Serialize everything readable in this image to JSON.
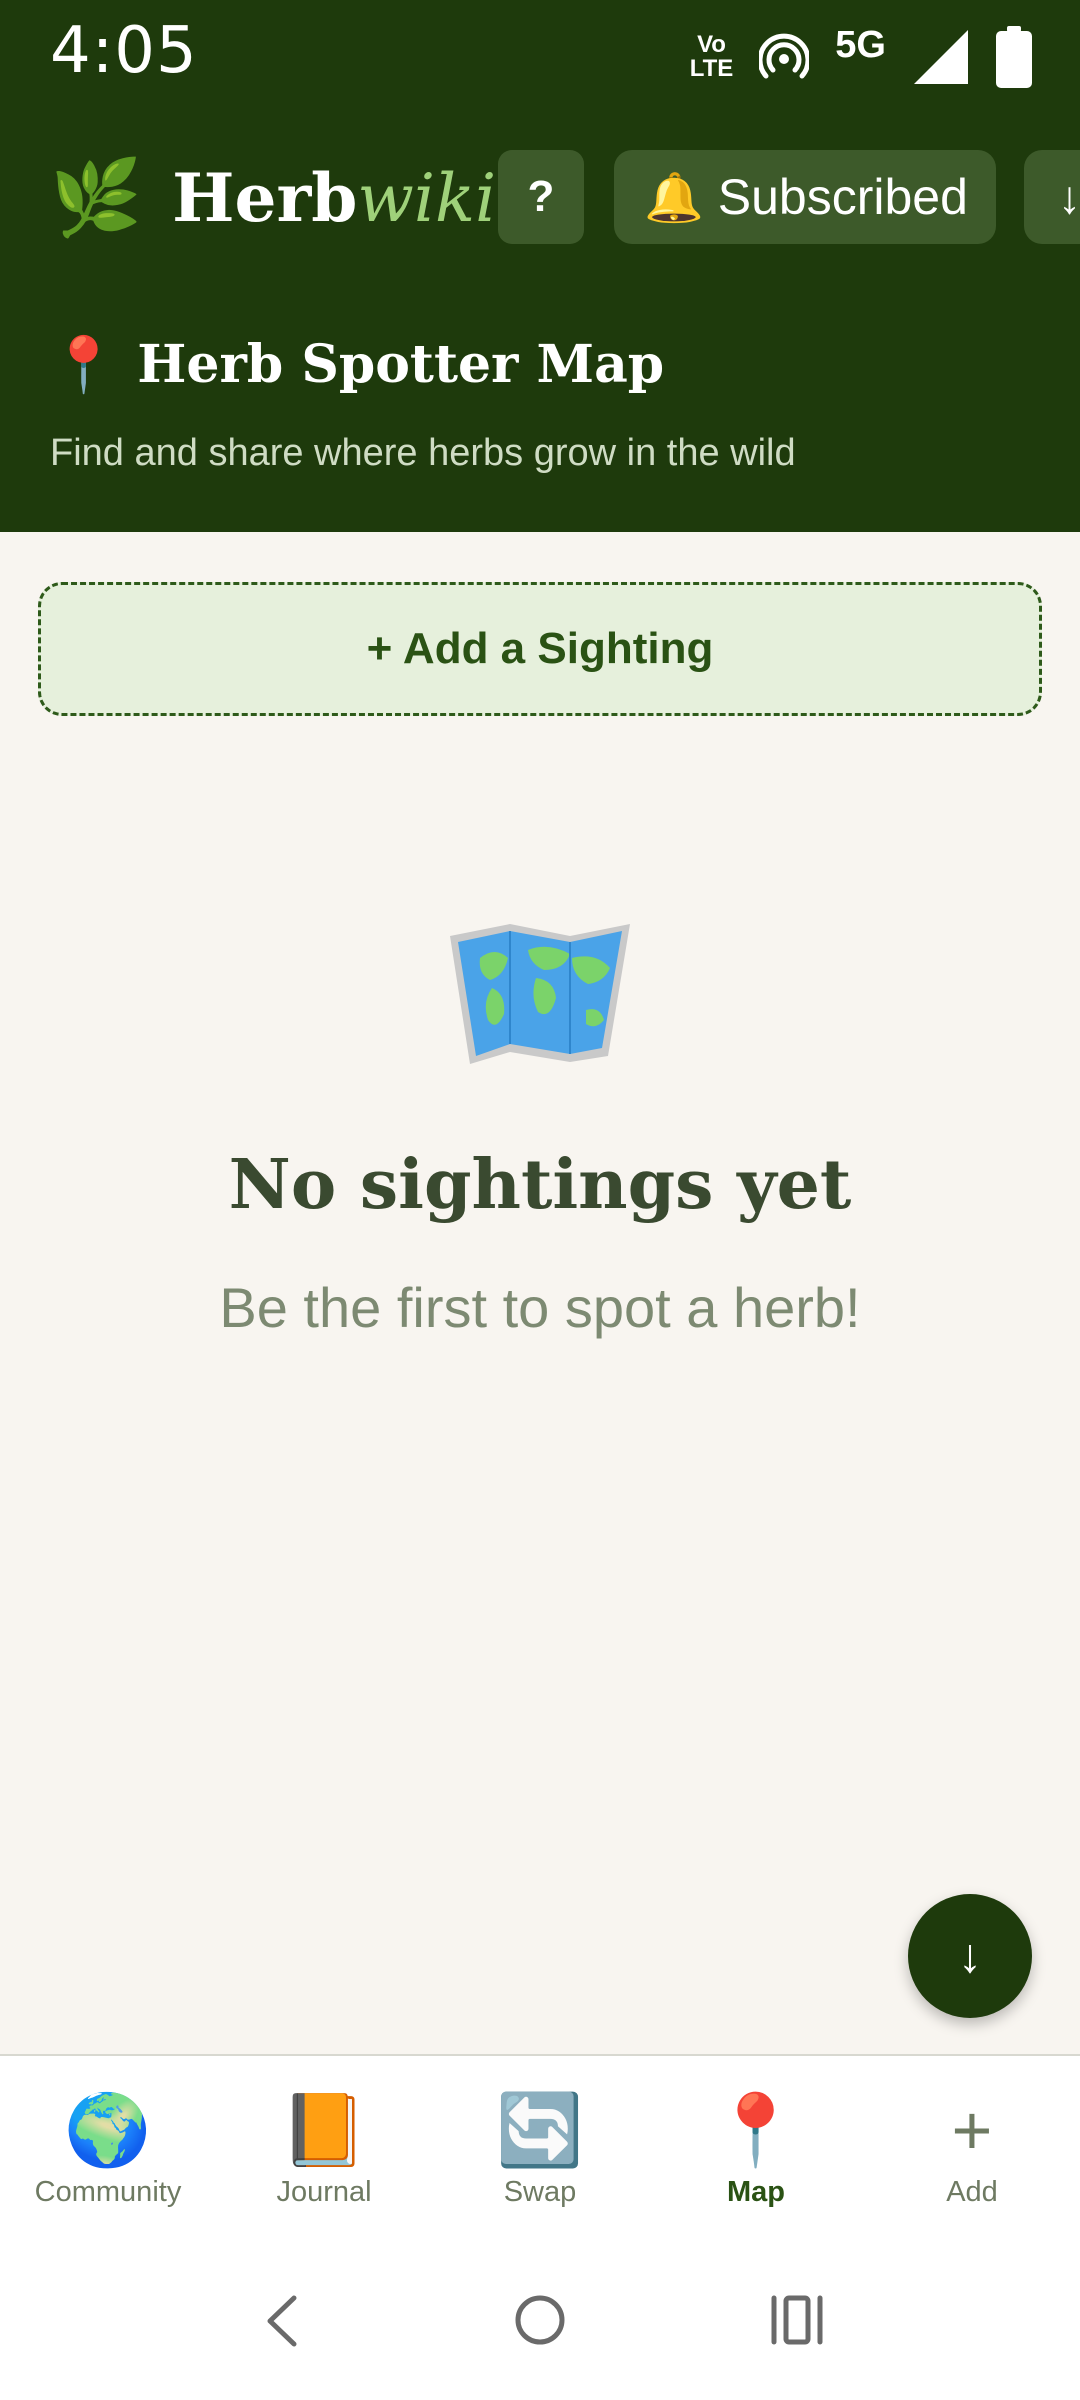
{
  "status_bar": {
    "time": "4:05",
    "volte_line1": "Vo",
    "volte_line2": "LTE",
    "network": "5G"
  },
  "header": {
    "brand_prefix": "Herb",
    "brand_suffix": "wiki",
    "leaf_icon": "🌿",
    "help_label": "?",
    "subscribe_icon": "🔔",
    "subscribe_label": "Subscribed",
    "more_label": "↓",
    "title_icon": "📍",
    "title": "Herb Spotter Map",
    "subtitle": "Find and share where herbs grow in the wild"
  },
  "main": {
    "add_sighting_label": "+ Add a Sighting",
    "empty_title": "No sightings yet",
    "empty_subtitle": "Be the first to spot a herb!"
  },
  "fab": {
    "label": "↓"
  },
  "bottom_nav": {
    "items": [
      {
        "icon": "🌍",
        "label": "Community"
      },
      {
        "icon": "📙",
        "label": "Journal"
      },
      {
        "icon": "🔄",
        "label": "Swap"
      },
      {
        "icon": "📍",
        "label": "Map"
      },
      {
        "icon": "+",
        "label": "Add"
      }
    ],
    "active": "Map"
  },
  "colors": {
    "header_bg": "#1e3a0c",
    "accent_green": "#9fd17a",
    "page_bg": "#f8f5f0",
    "add_button_bg": "#e6f0dc"
  }
}
